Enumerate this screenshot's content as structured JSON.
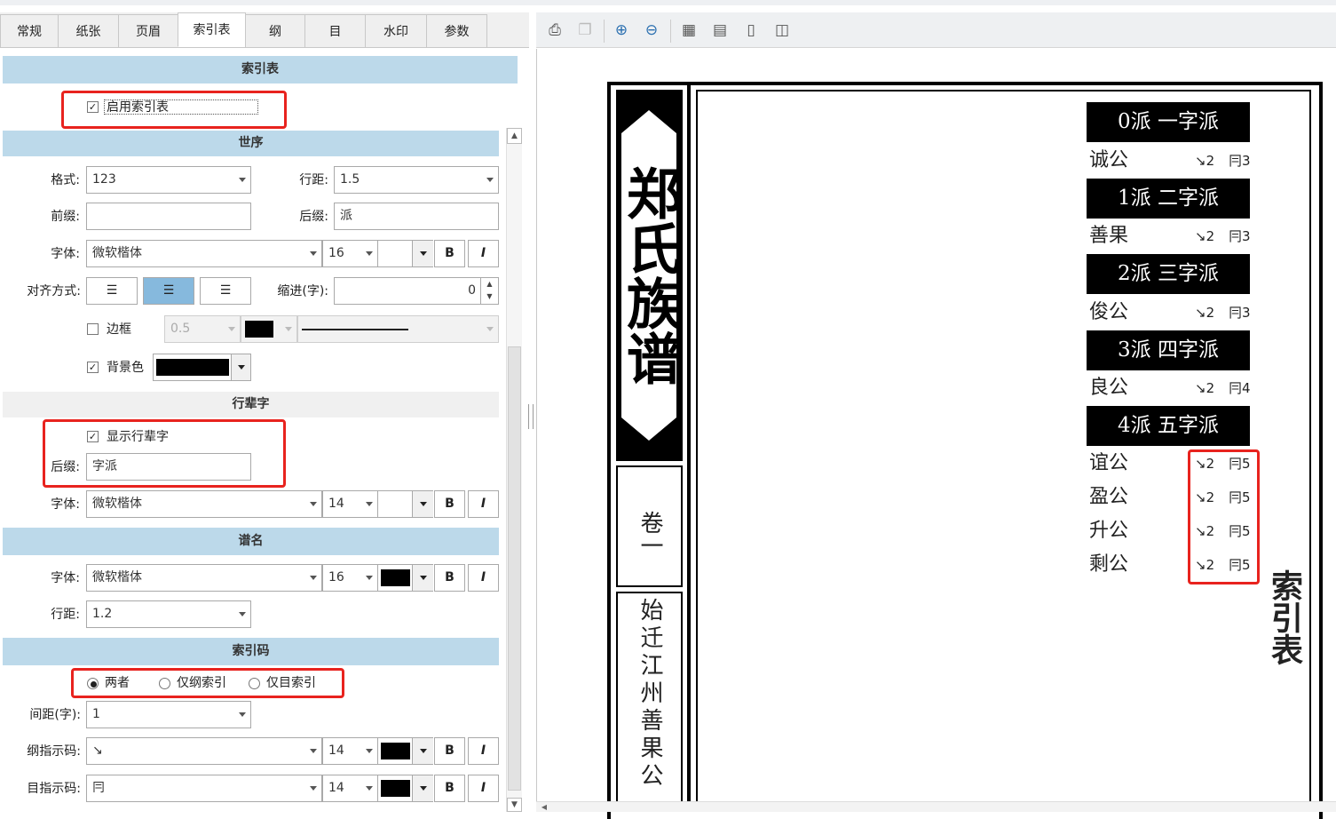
{
  "tabs": [
    "常规",
    "纸张",
    "页眉",
    "索引表",
    "纲",
    "目",
    "水印",
    "参数"
  ],
  "sections": {
    "index_table": "索引表",
    "shixu": "世序",
    "hangbeizi": "行辈字",
    "puming": "谱名",
    "index_code": "索引码"
  },
  "enable": {
    "label": "启用索引表",
    "checked": true
  },
  "shixu": {
    "format_label": "格式:",
    "format_value": "123",
    "line_spacing_label": "行距:",
    "line_spacing_value": "1.5",
    "prefix_label": "前缀:",
    "prefix_value": "",
    "suffix_label": "后缀:",
    "suffix_value": "派",
    "font_label": "字体:",
    "font_value": "微软楷体",
    "font_size": "16",
    "bold": "B",
    "italic": "I",
    "align_label": "对齐方式:",
    "indent_label": "缩进(字):",
    "indent_value": "0",
    "border_label": "边框",
    "border_checked": false,
    "border_width": "0.5",
    "bg_label": "背景色",
    "bg_checked": true,
    "bg_color": "#000000"
  },
  "hangbeizi": {
    "show_label": "显示行辈字",
    "show_checked": true,
    "suffix_label": "后缀:",
    "suffix_value": "字派",
    "font_label": "字体:",
    "font_value": "微软楷体",
    "font_size": "14",
    "bold": "B",
    "italic": "I"
  },
  "puming": {
    "font_label": "字体:",
    "font_value": "微软楷体",
    "font_size": "16",
    "color": "#000000",
    "bold": "B",
    "italic": "I",
    "line_spacing_label": "行距:",
    "line_spacing_value": "1.2"
  },
  "index_code": {
    "options": [
      "两者",
      "仅纲索引",
      "仅目索引"
    ],
    "selected": "两者",
    "spacing_label": "间距(字):",
    "spacing_value": "1",
    "gang_label": "纲指示码:",
    "gang_value": "↘",
    "gang_size": "14",
    "mu_label": "目指示码:",
    "mu_value": "冃",
    "mu_size": "14",
    "bold": "B",
    "italic": "I"
  },
  "toolbar_icons": [
    "print-icon",
    "copy-icon",
    "zoom-in-icon",
    "zoom-out-icon",
    "fit-page-icon",
    "fit-width-icon",
    "single-page-icon",
    "two-page-icon"
  ],
  "preview": {
    "title": "郑氏族谱",
    "volume": "卷一",
    "side_text": "始迁江州善果公一",
    "index_title": "索引表",
    "entries": [
      {
        "pai": "0派 一字派",
        "names": [
          {
            "name": "诚公",
            "gang": "↘2",
            "mu": "冃3"
          }
        ]
      },
      {
        "pai": "1派 二字派",
        "names": [
          {
            "name": "善果",
            "gang": "↘2",
            "mu": "冃3"
          }
        ]
      },
      {
        "pai": "2派 三字派",
        "names": [
          {
            "name": "俊公",
            "gang": "↘2",
            "mu": "冃3"
          }
        ]
      },
      {
        "pai": "3派 四字派",
        "names": [
          {
            "name": "良公",
            "gang": "↘2",
            "mu": "冃4"
          }
        ]
      },
      {
        "pai": "4派 五字派",
        "names": [
          {
            "name": "谊公",
            "gang": "↘2",
            "mu": "冃5"
          },
          {
            "name": "盈公",
            "gang": "↘2",
            "mu": "冃5"
          },
          {
            "name": "升公",
            "gang": "↘2",
            "mu": "冃5"
          },
          {
            "name": "剩公",
            "gang": "↘2",
            "mu": "冃5"
          }
        ]
      }
    ]
  }
}
